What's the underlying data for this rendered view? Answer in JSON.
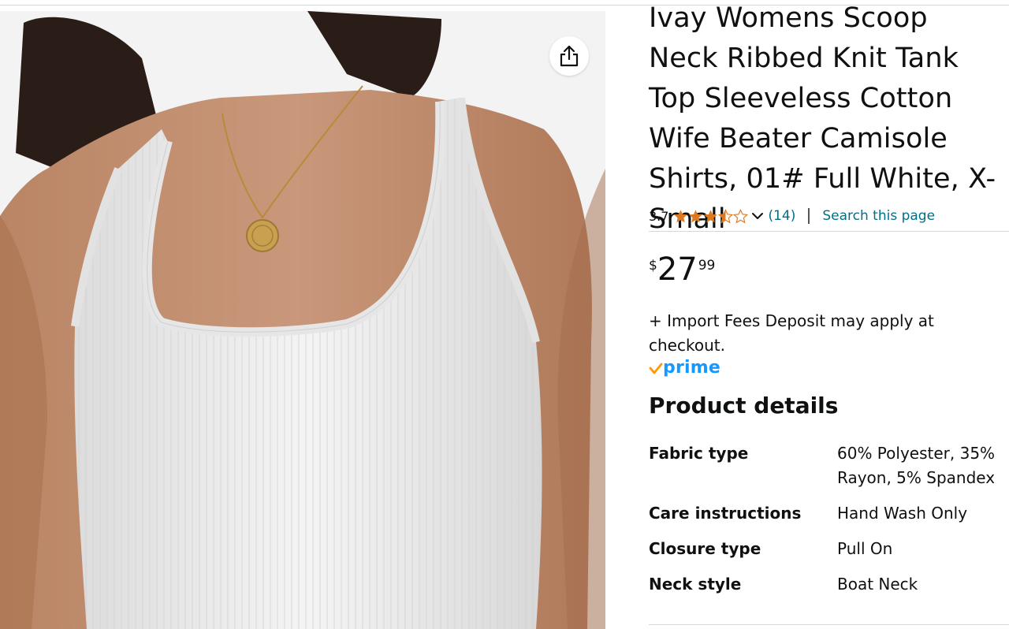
{
  "product": {
    "title": "Ivay Womens Scoop Neck Ribbed Knit Tank Top Sleeveless Cotton Wife Beater Camisole Shirts, 01# Full White, X-Small",
    "rating": "3.7",
    "rating_stars": 3.5,
    "review_count": "(14)",
    "search_link": "Search this page",
    "price": {
      "symbol": "$",
      "whole": "27",
      "fraction": "99"
    },
    "import_note": "+ Import Fees Deposit may apply at checkout.",
    "prime_label": "prime"
  },
  "details": {
    "title": "Product details",
    "rows": [
      {
        "label": "Fabric type",
        "value": "60% Polyester, 35% Rayon, 5% Spandex"
      },
      {
        "label": "Care instructions",
        "value": "Hand Wash Only"
      },
      {
        "label": "Closure type",
        "value": "Pull On"
      },
      {
        "label": "Neck style",
        "value": "Boat Neck"
      }
    ]
  },
  "icons": {
    "share": "share-icon",
    "star": "star-icon",
    "chevron": "chevron-down-icon",
    "prime_check": "prime-check-icon"
  },
  "colors": {
    "link": "#007185",
    "star": "#de7921",
    "prime": "#1399ff",
    "prime_check": "#ff9900",
    "text": "#0f1111"
  }
}
